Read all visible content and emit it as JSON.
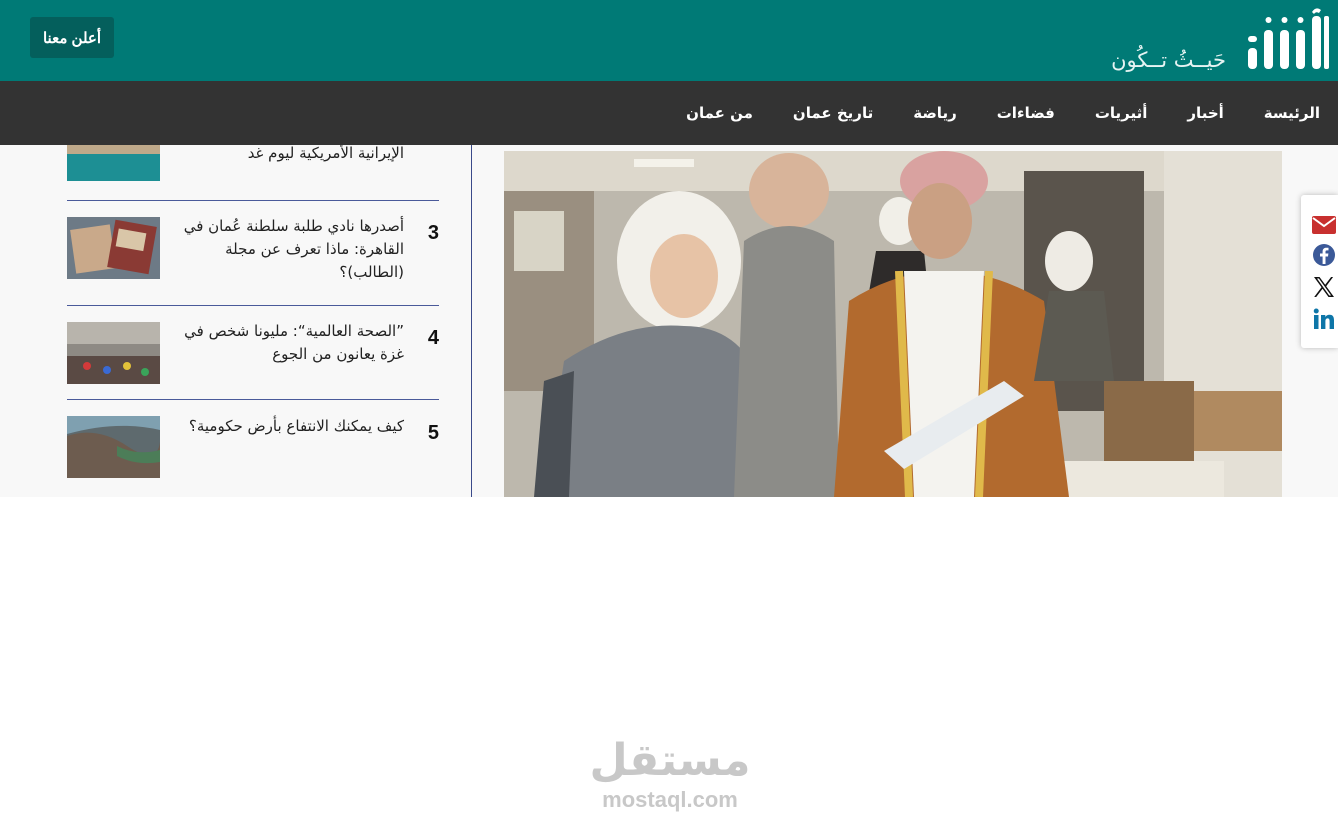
{
  "header": {
    "advertise_label": "أعلن معنا",
    "logo_tagline": "حَيــثُ تــكُون",
    "bg_color": "#007a76"
  },
  "nav": {
    "items": [
      "الرئيسة",
      "أخبار",
      "أثيريات",
      "فضاءات",
      "رياضة",
      "تاريخ عمان",
      "من عمان"
    ]
  },
  "sidebar": {
    "items": [
      {
        "number": "",
        "title": "الإيرانية الأمريكية ليوم غد"
      },
      {
        "number": "3",
        "title": "أصدرها نادي طلبة سلطنة عُمان في القاهرة: ماذا تعرف عن مجلة (الطالب)؟"
      },
      {
        "number": "4",
        "title": "”الصحة العالمية“: مليونا شخص في غزة يعانون من الجوع"
      },
      {
        "number": "5",
        "title": "كيف يمكنك الانتفاع بأرض حكومية؟"
      }
    ]
  },
  "share": {
    "icons": [
      "envelope-icon",
      "facebook-icon",
      "x-icon",
      "linkedin-icon"
    ]
  },
  "watermark": {
    "arabic": "مستقل",
    "latin": "mostaql.com"
  }
}
